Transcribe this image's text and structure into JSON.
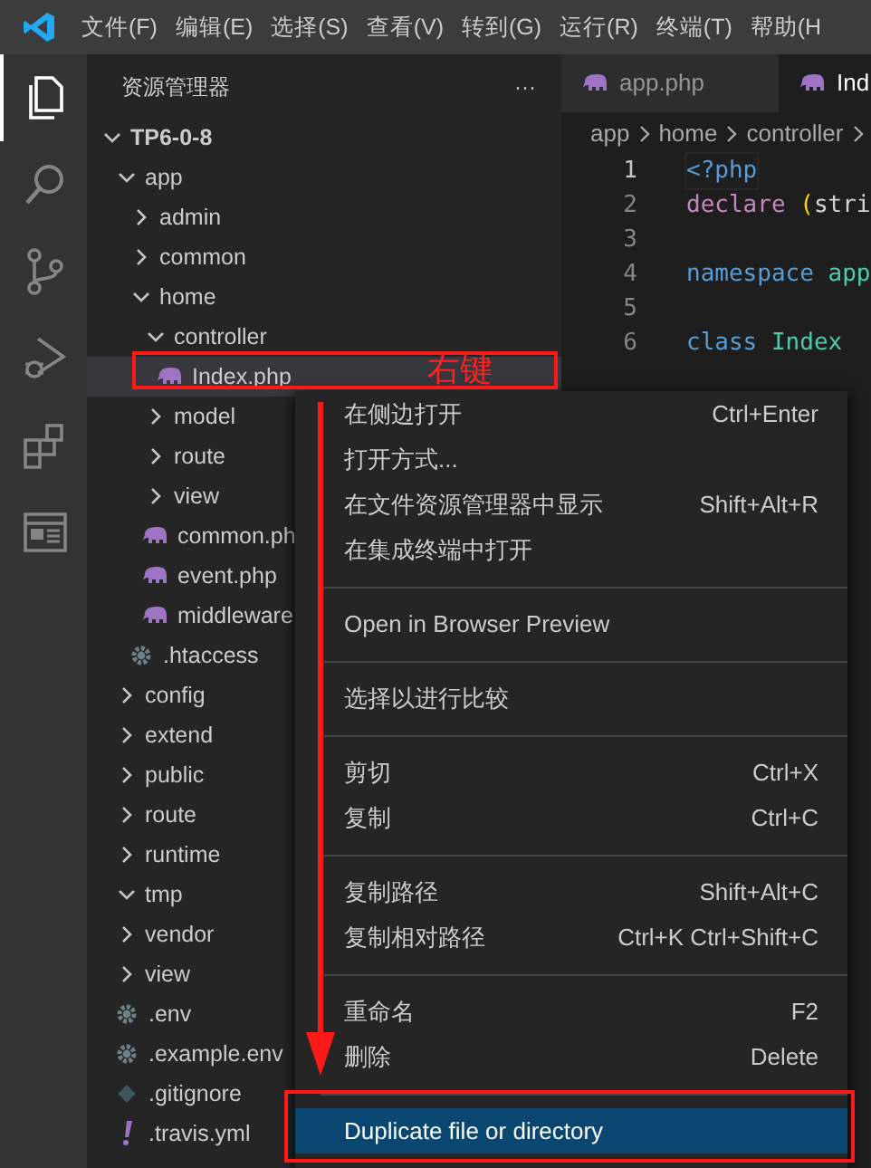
{
  "menu_bar": [
    "文件(F)",
    "编辑(E)",
    "选择(S)",
    "查看(V)",
    "转到(G)",
    "运行(R)",
    "终端(T)",
    "帮助(H"
  ],
  "activity_bar": [
    {
      "kind": "explorer",
      "selected": true
    },
    {
      "kind": "search",
      "selected": false
    },
    {
      "kind": "source-control",
      "selected": false
    },
    {
      "kind": "debug",
      "selected": false
    },
    {
      "kind": "extensions",
      "selected": false
    },
    {
      "kind": "browser",
      "selected": false
    }
  ],
  "sidebar": {
    "title": "资源管理器",
    "more": "···",
    "tree": [
      {
        "label": "TP6-0-8",
        "kind": "folder",
        "expanded": true,
        "selected": false,
        "children": [
          {
            "label": "app",
            "kind": "folder",
            "expanded": true,
            "selected": false,
            "children": [
              {
                "label": "admin",
                "kind": "folder",
                "expanded": false,
                "selected": false
              },
              {
                "label": "common",
                "kind": "folder",
                "expanded": false,
                "selected": false
              },
              {
                "label": "home",
                "kind": "folder",
                "expanded": true,
                "selected": false,
                "children": [
                  {
                    "label": "controller",
                    "kind": "folder",
                    "expanded": true,
                    "selected": false,
                    "children": [
                      {
                        "label": "Index.php",
                        "kind": "php",
                        "selected": true
                      }
                    ]
                  },
                  {
                    "label": "model",
                    "kind": "folder",
                    "expanded": false,
                    "selected": false
                  },
                  {
                    "label": "route",
                    "kind": "folder",
                    "expanded": false,
                    "selected": false
                  },
                  {
                    "label": "view",
                    "kind": "folder",
                    "expanded": false,
                    "selected": false
                  },
                  {
                    "label": "common.ph",
                    "kind": "php",
                    "selected": false
                  },
                  {
                    "label": "event.php",
                    "kind": "php",
                    "selected": false
                  },
                  {
                    "label": "middleware",
                    "kind": "php",
                    "selected": false
                  }
                ]
              },
              {
                "label": ".htaccess",
                "kind": "config",
                "selected": false
              }
            ]
          },
          {
            "label": "config",
            "kind": "folder",
            "expanded": false,
            "selected": false
          },
          {
            "label": "extend",
            "kind": "folder",
            "expanded": false,
            "selected": false
          },
          {
            "label": "public",
            "kind": "folder",
            "expanded": false,
            "selected": false
          },
          {
            "label": "route",
            "kind": "folder",
            "expanded": false,
            "selected": false
          },
          {
            "label": "runtime",
            "kind": "folder",
            "expanded": false,
            "selected": false
          },
          {
            "label": "tmp",
            "kind": "folder",
            "expanded": true,
            "selected": false
          },
          {
            "label": "vendor",
            "kind": "folder",
            "expanded": false,
            "selected": false
          },
          {
            "label": "view",
            "kind": "folder",
            "expanded": false,
            "selected": false
          },
          {
            "label": ".env",
            "kind": "config",
            "selected": false
          },
          {
            "label": ".example.env",
            "kind": "config",
            "selected": false
          },
          {
            "label": ".gitignore",
            "kind": "git",
            "selected": false
          },
          {
            "label": ".travis.yml",
            "kind": "yaml",
            "selected": false
          }
        ]
      }
    ]
  },
  "editor": {
    "tabs": [
      {
        "label": "app.php",
        "selected": false
      },
      {
        "label": "Ind",
        "selected": true
      }
    ],
    "breadcrumb": [
      "app",
      "home",
      "controller"
    ],
    "lines": [
      {
        "number": "1",
        "tokens": [
          {
            "text": "<?php",
            "kind": "keyword"
          }
        ]
      },
      {
        "number": "2",
        "tokens": [
          {
            "text": "declare ",
            "kind": "control"
          },
          {
            "text": "(",
            "kind": "bracket"
          },
          {
            "text": "stri",
            "kind": "plain"
          }
        ]
      },
      {
        "number": "3"
      },
      {
        "number": "4",
        "tokens": [
          {
            "text": "namespace ",
            "kind": "keyword"
          },
          {
            "text": "app",
            "kind": "type"
          }
        ]
      },
      {
        "number": "5"
      },
      {
        "number": "6",
        "tokens": [
          {
            "text": "class ",
            "kind": "keyword"
          },
          {
            "text": "Index",
            "kind": "type"
          }
        ]
      }
    ]
  },
  "context_menu": {
    "groups": [
      [
        {
          "label": "在侧边打开",
          "shortcut": "Ctrl+Enter",
          "selected": false
        },
        {
          "label": "打开方式...",
          "selected": false
        },
        {
          "label": "在文件资源管理器中显示",
          "shortcut": "Shift+Alt+R",
          "selected": false
        },
        {
          "label": "在集成终端中打开",
          "selected": false
        }
      ],
      [
        {
          "label": "Open in Browser Preview",
          "selected": false
        }
      ],
      [
        {
          "label": "选择以进行比较",
          "selected": false
        }
      ],
      [
        {
          "label": "剪切",
          "shortcut": "Ctrl+X",
          "selected": false
        },
        {
          "label": "复制",
          "shortcut": "Ctrl+C",
          "selected": false
        }
      ],
      [
        {
          "label": "复制路径",
          "shortcut": "Shift+Alt+C",
          "selected": false
        },
        {
          "label": "复制相对路径",
          "shortcut": "Ctrl+K Ctrl+Shift+C",
          "selected": false
        }
      ],
      [
        {
          "label": "重命名",
          "shortcut": "F2",
          "selected": false
        },
        {
          "label": "删除",
          "shortcut": "Delete",
          "selected": false
        }
      ],
      [
        {
          "label": "Duplicate file or directory",
          "selected": true
        }
      ]
    ]
  },
  "annotation": {
    "label": "右键"
  }
}
